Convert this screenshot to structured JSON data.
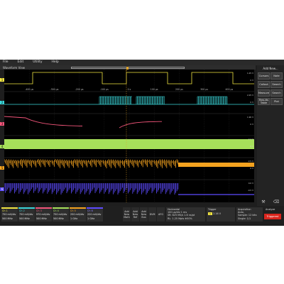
{
  "menu": [
    "File",
    "Edit",
    "Utility",
    "Help"
  ],
  "waveform_view": {
    "title": "Waveform View"
  },
  "time_ticks": [
    "-400 μs",
    "-300 μs",
    "-200 μs",
    "-100 μs",
    "0 s",
    "100 μs",
    "200 μs",
    "300 μs",
    "400 μs"
  ],
  "channels": [
    {
      "id": "1",
      "color": "#f0e442"
    },
    {
      "id": "2",
      "color": "#3ad5d9"
    },
    {
      "id": "3",
      "color": "#f2557a"
    },
    {
      "id": "4",
      "color": "#a6e05a"
    },
    {
      "id": "5",
      "color": "#f3a21f"
    },
    {
      "id": "6",
      "color": "#5d4bff"
    }
  ],
  "lane_labels": [
    "1",
    "2",
    "3",
    "4",
    "5",
    "6"
  ],
  "right_panel": {
    "add_new": "Add New...",
    "buttons": [
      "Cursors",
      "Note",
      "Callout",
      "Search",
      "Measure",
      "Search",
      "Results Table",
      "Plot"
    ]
  },
  "channel_badges": [
    {
      "name": "Ch 1",
      "scale": "750 mV/div",
      "bw": "500 MHz",
      "color": "#f0e442"
    },
    {
      "name": "Ch 2",
      "scale": "750 mV/div",
      "bw": "500 MHz",
      "color": "#3ad5d9"
    },
    {
      "name": "Ch 3",
      "scale": "970 mV/div",
      "bw": "500 MHz",
      "color": "#f2557a"
    },
    {
      "name": "Ch 4",
      "scale": "750 mV/div",
      "bw": "500 MHz",
      "color": "#a6e05a"
    },
    {
      "name": "Ch 5",
      "scale": "250 mV/div",
      "bw": "1 GHz",
      "color": "#f3a21f"
    },
    {
      "name": "Ch 6",
      "scale": "220 mV/div",
      "bw": "1 GHz",
      "color": "#5d4bff"
    }
  ],
  "bottom_buttons": [
    "Add New Math",
    "Add New Ref",
    "Add New Bus",
    "DVM",
    "AFG"
  ],
  "horizontal": {
    "title": "Horizontal",
    "line1": "100 μs/div   1 ms",
    "line2": "SR: 625 MS/s   1.6 ns/pt",
    "line3": "RL: 1.25 Mpts   ⊕50%"
  },
  "trigger": {
    "title": "Trigger",
    "value": "2.16 V"
  },
  "acquisition": {
    "title": "Acquisition",
    "line1": "Auto,",
    "line2": "Sample: 12 bits",
    "line3": "Single: 1/1",
    "extra": "Analyze"
  },
  "status": "Triggered",
  "scale_labels": {
    "ch1": [
      "1.25 V",
      "0 V"
    ],
    "ch2": [
      "2.25 V",
      "0 V"
    ],
    "ch3": [
      "1.90 V",
      "0 V"
    ],
    "ch4": [
      "2.2 V",
      "0 V"
    ],
    "ch5": [
      "2.5 V",
      "0 V"
    ],
    "ch6": [
      "0.0 V",
      "-0.5 V"
    ]
  }
}
